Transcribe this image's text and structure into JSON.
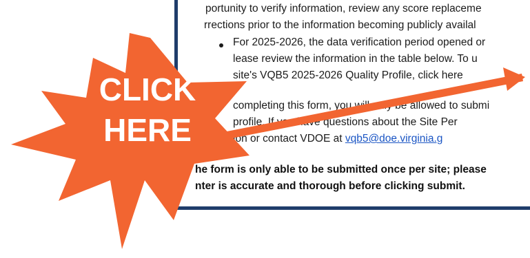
{
  "document": {
    "line1": "portunity to verify information, review any score replaceme",
    "line2": "rrections prior to the information becoming publicly availal",
    "line3": "For 2025-2026, the data verification period opened or",
    "line4": "lease review the information in the table below. To u",
    "line5": "site's VQB5 2025-2026 Quality Profile, click here",
    "line6": "completing this form, you will only be allowed to submi",
    "line7": "profile. If you have questions about the Site Per",
    "line8_prefix": "ion or contact VDOE at ",
    "email_link": "vqb5@doe.virginia.g",
    "line9": "he form is only able to be submitted once per site; please",
    "line10": "nter is accurate and thorough before clicking submit."
  },
  "callout": {
    "line1": "CLICK",
    "line2": "HERE",
    "burst_color": "#f26531",
    "arrow_color": "#f26531"
  }
}
